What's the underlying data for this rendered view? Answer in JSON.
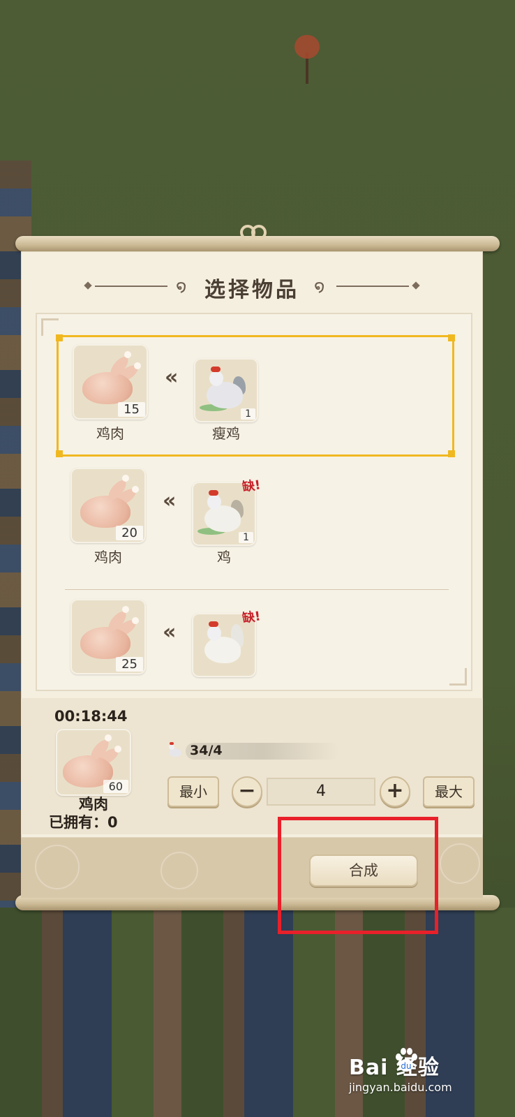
{
  "dialog": {
    "title": "选择物品"
  },
  "recipes": [
    {
      "output_name": "鸡肉",
      "output_count": "15",
      "input_name": "瘦鸡",
      "input_count": "1",
      "lacking": ""
    },
    {
      "output_name": "鸡肉",
      "output_count": "20",
      "input_name": "鸡",
      "input_count": "1",
      "lacking": "缺!"
    },
    {
      "output_name": "",
      "output_count": "25",
      "input_name": "",
      "input_count": "",
      "lacking": "缺!"
    }
  ],
  "craft_panel": {
    "timer": "00:18:44",
    "output_name": "鸡肉",
    "output_count": "60",
    "owned_label": "已拥有：0",
    "requirement": "34/4",
    "min_label": "最小",
    "max_label": "最大",
    "minus_label": "−",
    "plus_label": "+",
    "quantity": "4",
    "craft_label": "合成"
  },
  "watermark": {
    "brand": "Bai  经验",
    "url": "jingyan.baidu.com"
  },
  "colors": {
    "selected_border": "#f0b820",
    "highlight_box": "#e8202a",
    "panel_bg": "#f5efe0",
    "lack_text": "#c8202a"
  }
}
